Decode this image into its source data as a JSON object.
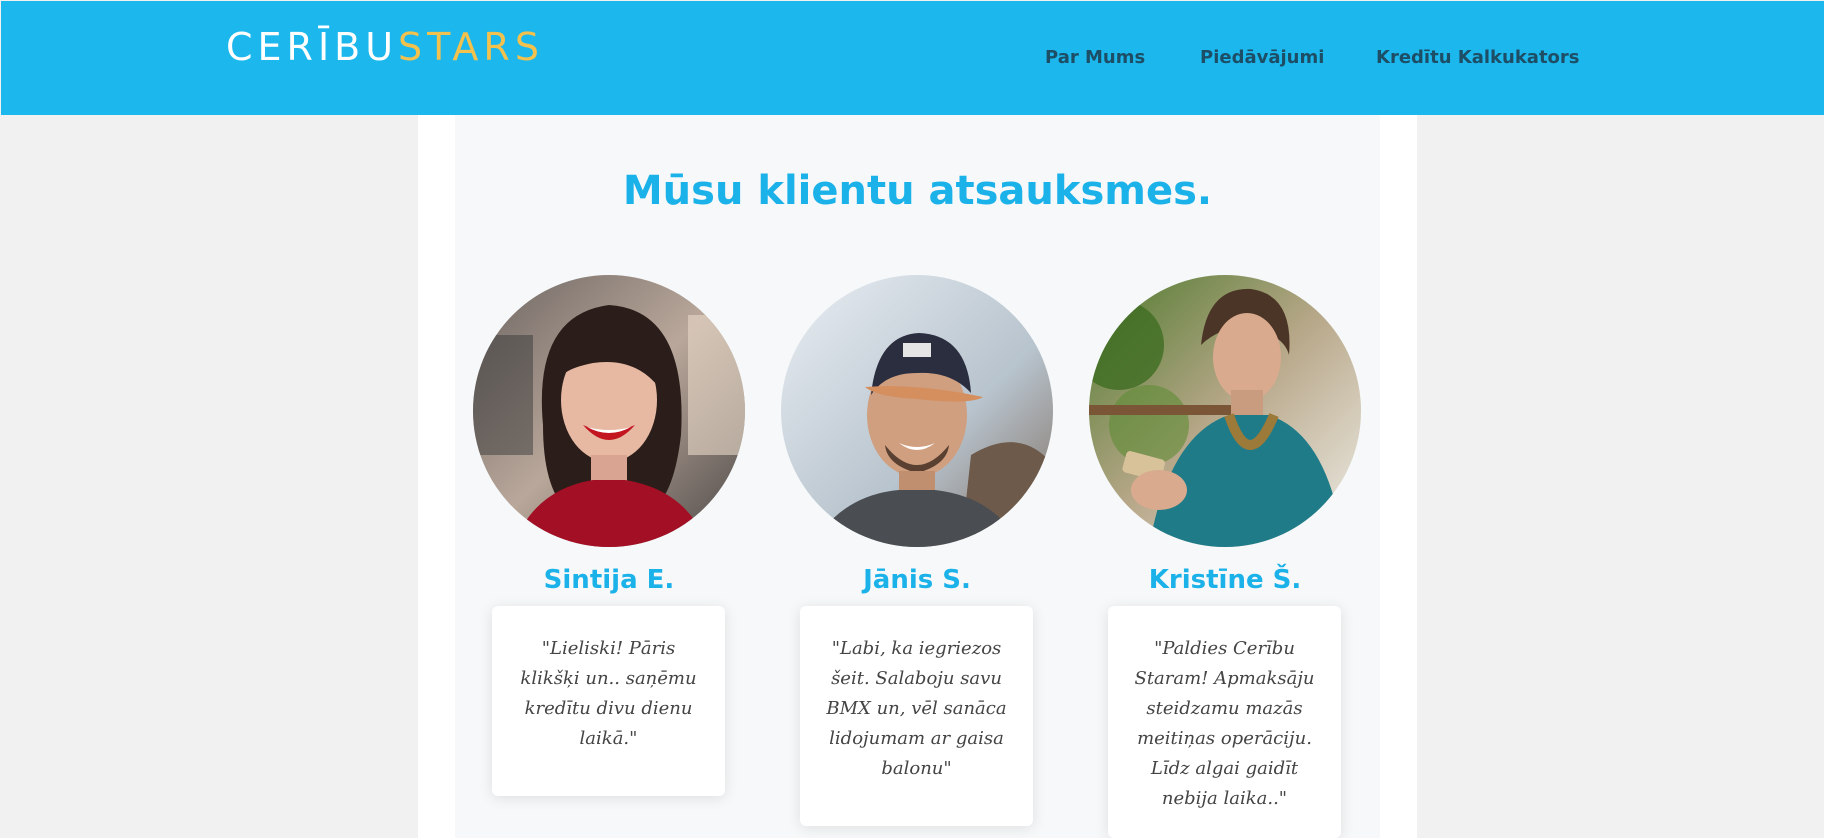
{
  "header": {
    "logo_part1": "CERĪBU",
    "logo_part2": "STARS",
    "nav": [
      "Par Mums",
      "Piedāvājumi",
      "Kredītu Kalkukators"
    ]
  },
  "section": {
    "title": "Mūsu klientu atsauksmes."
  },
  "testimonials": [
    {
      "name": "Sintija E.",
      "quote": "\"Lieliski! Pāris klikšķi un.. saņēmu kredītu divu dienu laikā.\""
    },
    {
      "name": "Jānis S.",
      "quote": "\"Labi, ka iegriezos šeit. Salaboju savu BMX un, vēl sanāca lidojumam ar gaisa balonu\""
    },
    {
      "name": "Kristīne Š.",
      "quote": "\"Paldies Cerību Staram! Apmaksāju steidzamu mazās meitiņas operāciju. Līdz algai gaidīt nebija laika..\""
    }
  ],
  "colors": {
    "header_bg": "#1bb7ed",
    "accent": "#1bb1e9",
    "logo_gold": "#f2c14e",
    "nav_text": "#1d4e66"
  }
}
